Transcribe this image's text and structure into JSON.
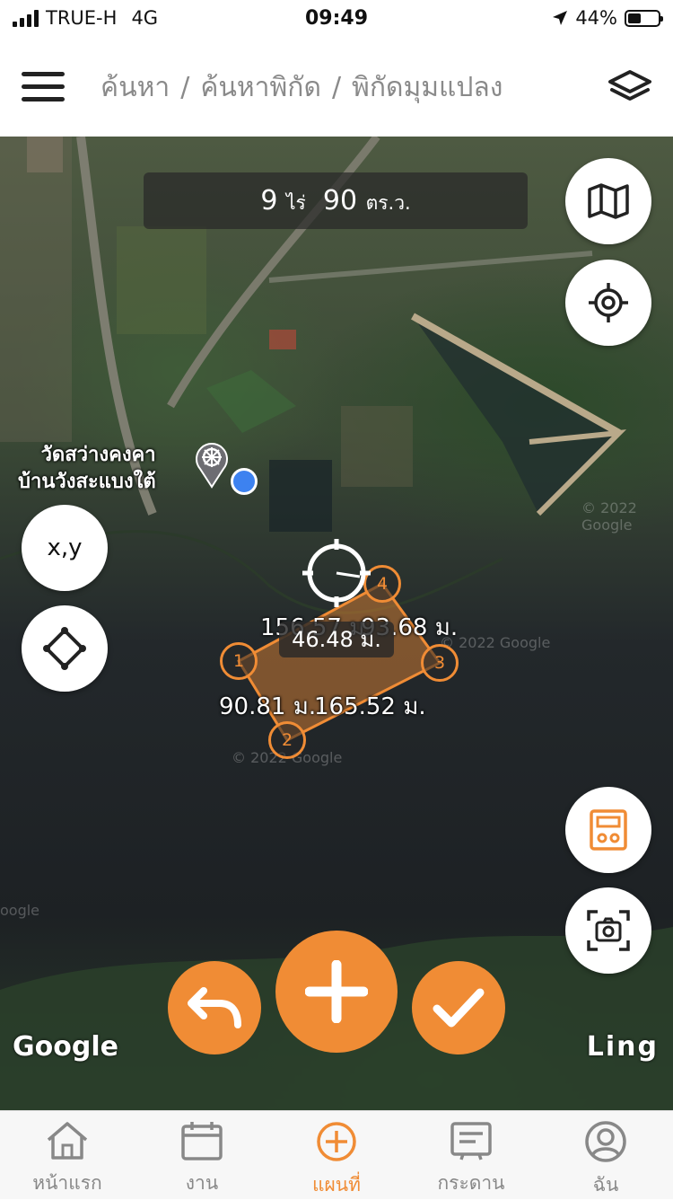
{
  "status": {
    "carrier": "TRUE-H",
    "network": "4G",
    "time": "09:49",
    "battery": "44%",
    "battery_level": 0.44
  },
  "header": {
    "crumbs": [
      "ค้นหา",
      "ค้นหาพิกัด",
      "พิกัดมุมแปลง"
    ],
    "separator": "/"
  },
  "map": {
    "area": {
      "rai": "9",
      "rai_unit": "ไร่",
      "wah": "90",
      "wah_unit": "ตร.ว."
    },
    "poi": {
      "line1": "วัดสว่างคงคา",
      "line2": "บ้านวังสะแบงใต้"
    },
    "xy_label": "x,y",
    "google_label": "Google",
    "ling_label": "Ling",
    "watermarks": [
      "© 2022 Google",
      "© 2022 Google",
      "© 2022 Google",
      "oogle"
    ],
    "segments": {
      "s14": "156.57 ม.",
      "s43": "93.68 ม.",
      "s12": "90.81 ม.",
      "s23": "165.52 ม.",
      "center": "46.48 ม."
    },
    "vertices": [
      "1",
      "2",
      "3",
      "4"
    ]
  },
  "colors": {
    "accent": "#f08c35",
    "gps": "#3d82f0"
  },
  "icons": [
    "menu-icon",
    "layers-icon",
    "map-icon",
    "locate-icon",
    "polygon-icon",
    "calculator-icon",
    "camera-icon",
    "undo-icon",
    "plus-icon",
    "check-icon",
    "home-icon",
    "calendar-icon",
    "map-add-icon",
    "board-icon",
    "user-icon"
  ],
  "tabs": [
    {
      "label": "หน้าแรก"
    },
    {
      "label": "งาน"
    },
    {
      "label": "แผนที่"
    },
    {
      "label": "กระดาน"
    },
    {
      "label": "ฉัน"
    }
  ]
}
